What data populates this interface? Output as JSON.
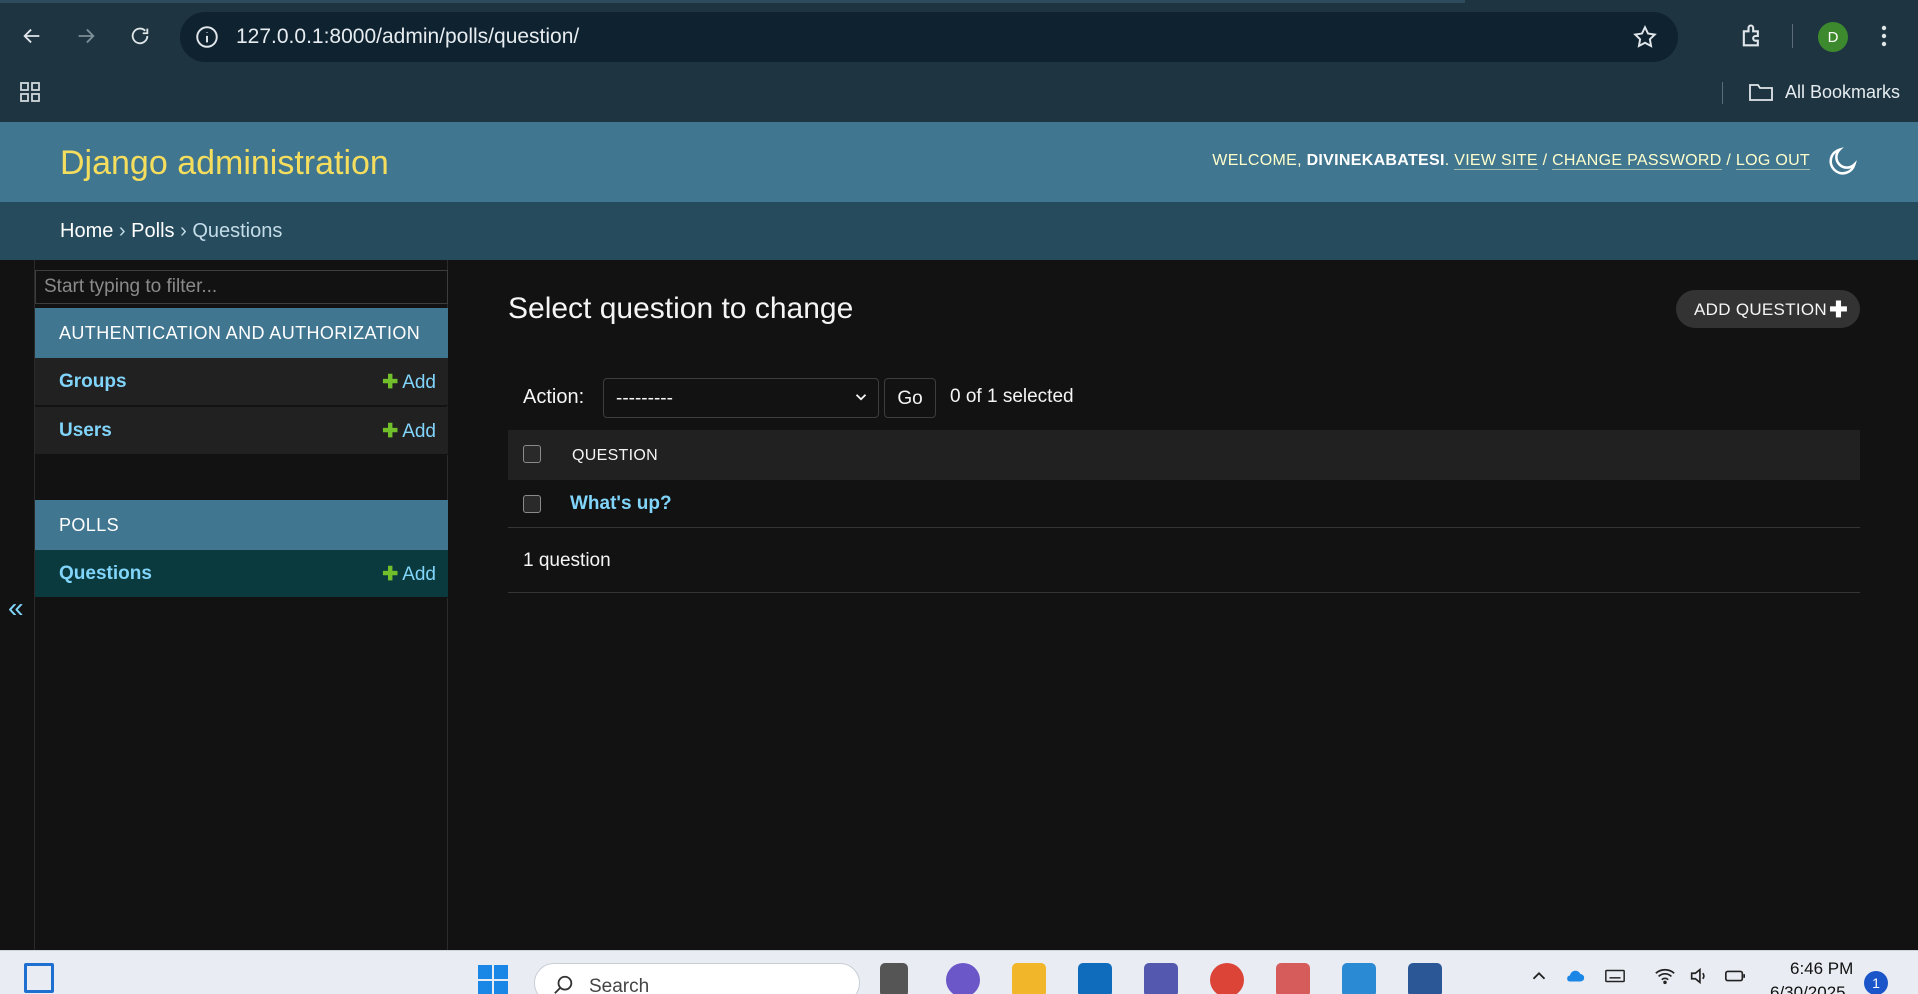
{
  "browser": {
    "url": "127.0.0.1:8000/admin/polls/question/",
    "bookmarks_label": "All Bookmarks",
    "profile_initial": "D"
  },
  "header": {
    "brand": "Django administration",
    "welcome": "WELCOME,",
    "username": "DIVINEKABATESI",
    "view_site": "VIEW SITE",
    "change_password": "CHANGE PASSWORD",
    "log_out": "LOG OUT",
    "separator": "/"
  },
  "breadcrumbs": {
    "home": "Home",
    "polls": "Polls",
    "current": "Questions",
    "sep": "›"
  },
  "sidebar": {
    "filter_placeholder": "Start typing to filter...",
    "modules": [
      {
        "caption": "AUTHENTICATION AND AUTHORIZATION",
        "models": [
          {
            "name": "Groups",
            "add": "Add"
          },
          {
            "name": "Users",
            "add": "Add"
          }
        ]
      },
      {
        "caption": "POLLS",
        "models": [
          {
            "name": "Questions",
            "add": "Add"
          }
        ]
      }
    ],
    "collapse_glyph": "«"
  },
  "content": {
    "title": "Select question to change",
    "add_button": "ADD QUESTION",
    "action_label": "Action:",
    "action_selected": "---------",
    "go_button": "Go",
    "selected_count": "0 of 1 selected",
    "column_header": "QUESTION",
    "rows": [
      "What's up?"
    ],
    "result_count": "1 question"
  },
  "taskbar": {
    "search": "Search",
    "time": "6:46 PM",
    "date": "6/30/2025",
    "notifications": "1"
  },
  "colors": {
    "header_bg": "#417690",
    "brand": "#f5dd5d",
    "link": "#81d4fa",
    "add_plus": "#70bf2b",
    "body_bg": "#121212"
  }
}
